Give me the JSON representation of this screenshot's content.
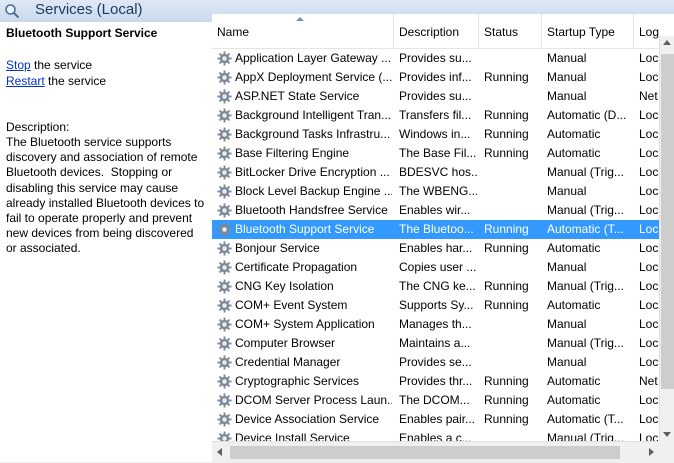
{
  "window": {
    "title": "Services (Local)"
  },
  "details": {
    "service_name": "Bluetooth Support Service",
    "actions": [
      {
        "link": "Stop",
        "suffix": " the service"
      },
      {
        "link": "Restart",
        "suffix": " the service"
      }
    ],
    "description_label": "Description:",
    "description": "The Bluetooth service supports\ndiscovery and association of remote\nBluetooth devices.  Stopping or\ndisabling this service may cause\nalready installed Bluetooth devices to\nfail to operate properly and prevent\nnew devices from being discovered\nor associated."
  },
  "columns": [
    "Name",
    "Description",
    "Status",
    "Startup Type",
    "Log"
  ],
  "rows": [
    {
      "name": "Application Layer Gateway ...",
      "desc": "Provides su...",
      "status": "",
      "startup": "Manual",
      "log": "Loc"
    },
    {
      "name": "AppX Deployment Service (...",
      "desc": "Provides inf...",
      "status": "Running",
      "startup": "Manual",
      "log": "Loc"
    },
    {
      "name": "ASP.NET State Service",
      "desc": "Provides su...",
      "status": "",
      "startup": "Manual",
      "log": "Net"
    },
    {
      "name": "Background Intelligent Tran...",
      "desc": "Transfers fil...",
      "status": "Running",
      "startup": "Automatic (D...",
      "log": "Loc"
    },
    {
      "name": "Background Tasks Infrastru...",
      "desc": "Windows in...",
      "status": "Running",
      "startup": "Automatic",
      "log": "Loc"
    },
    {
      "name": "Base Filtering Engine",
      "desc": "The Base Fil...",
      "status": "Running",
      "startup": "Automatic",
      "log": "Loc"
    },
    {
      "name": "BitLocker Drive Encryption ...",
      "desc": "BDESVC hos...",
      "status": "",
      "startup": "Manual (Trig...",
      "log": "Loc"
    },
    {
      "name": "Block Level Backup Engine ...",
      "desc": "The WBENG...",
      "status": "",
      "startup": "Manual",
      "log": "Loc"
    },
    {
      "name": "Bluetooth Handsfree Service",
      "desc": "Enables wir...",
      "status": "",
      "startup": "Manual (Trig...",
      "log": "Loc"
    },
    {
      "name": "Bluetooth Support Service",
      "desc": "The Bluetoo...",
      "status": "Running",
      "startup": "Automatic (T...",
      "log": "Loc",
      "selected": true
    },
    {
      "name": "Bonjour Service",
      "desc": "Enables har...",
      "status": "Running",
      "startup": "Automatic",
      "log": "Loc"
    },
    {
      "name": "Certificate Propagation",
      "desc": "Copies user ...",
      "status": "",
      "startup": "Manual",
      "log": "Loc"
    },
    {
      "name": "CNG Key Isolation",
      "desc": "The CNG ke...",
      "status": "Running",
      "startup": "Manual (Trig...",
      "log": "Loc"
    },
    {
      "name": "COM+ Event System",
      "desc": "Supports Sy...",
      "status": "Running",
      "startup": "Automatic",
      "log": "Loc"
    },
    {
      "name": "COM+ System Application",
      "desc": "Manages th...",
      "status": "",
      "startup": "Manual",
      "log": "Loc"
    },
    {
      "name": "Computer Browser",
      "desc": "Maintains a...",
      "status": "",
      "startup": "Manual (Trig...",
      "log": "Loc"
    },
    {
      "name": "Credential Manager",
      "desc": "Provides se...",
      "status": "",
      "startup": "Manual",
      "log": "Loc"
    },
    {
      "name": "Cryptographic Services",
      "desc": "Provides thr...",
      "status": "Running",
      "startup": "Automatic",
      "log": "Net"
    },
    {
      "name": "DCOM Server Process Laun...",
      "desc": "The DCOM...",
      "status": "Running",
      "startup": "Automatic",
      "log": "Loc"
    },
    {
      "name": "Device Association Service",
      "desc": "Enables pair...",
      "status": "Running",
      "startup": "Automatic (T...",
      "log": "Loc"
    },
    {
      "name": "Device Install Service",
      "desc": "Enables a c...",
      "status": "",
      "startup": "Manual (Trig...",
      "log": "Loc"
    }
  ]
}
